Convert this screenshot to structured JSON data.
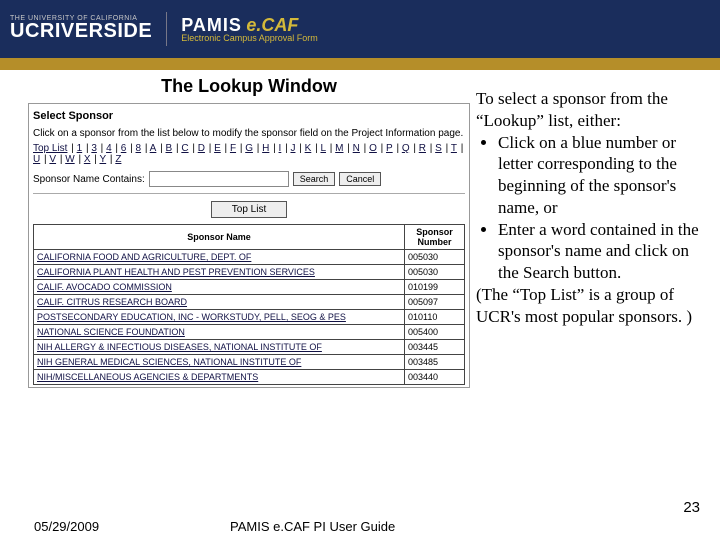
{
  "header": {
    "univ_top": "THE UNIVERSITY OF CALIFORNIA",
    "brand": "UCRIVERSIDE",
    "pamis": "PAMIS",
    "ecaf": "e.CAF",
    "tag": "Electronic Campus Approval Form"
  },
  "caption": "The Lookup Window",
  "lookup": {
    "title": "Select Sponsor",
    "instruction": "Click on a sponsor from the list below to modify the sponsor field on the Project Information page.",
    "top_link": "Top List",
    "digits_letters": [
      "1",
      "3",
      "4",
      "6",
      "8",
      "A",
      "B",
      "C",
      "D",
      "E",
      "F",
      "G",
      "H",
      "I",
      "J",
      "K",
      "L",
      "M",
      "N",
      "O",
      "P",
      "Q",
      "R",
      "S",
      "T",
      "U",
      "V",
      "W",
      "X",
      "Y",
      "Z"
    ],
    "search_label": "Sponsor Name Contains:",
    "search_btn": "Search",
    "cancel_btn": "Cancel",
    "top_list_button": "Top List",
    "table": {
      "headers": [
        "Sponsor Name",
        "Sponsor Number"
      ],
      "rows": [
        [
          "CALIFORNIA FOOD AND AGRICULTURE, DEPT. OF",
          "005030"
        ],
        [
          "CALIFORNIA PLANT HEALTH AND PEST PREVENTION SERVICES",
          "005030"
        ],
        [
          "CALIF. AVOCADO COMMISSION",
          "010199"
        ],
        [
          "CALIF. CITRUS RESEARCH BOARD",
          "005097"
        ],
        [
          "POSTSECONDARY EDUCATION, INC - WORKSTUDY, PELL, SEOG & PES",
          "010110"
        ],
        [
          "NATIONAL SCIENCE FOUNDATION",
          "005400"
        ],
        [
          "NIH ALLERGY & INFECTIOUS DISEASES, NATIONAL INSTITUTE OF",
          "003445"
        ],
        [
          "NIH GENERAL MEDICAL SCIENCES, NATIONAL INSTITUTE OF",
          "003485"
        ],
        [
          "NIH/MISCELLANEOUS AGENCIES & DEPARTMENTS",
          "003440"
        ]
      ]
    }
  },
  "notes": {
    "intro_a": "To select a sponsor from the “Lookup” list, either:",
    "bullet1": "Click on a blue number or letter corresponding to the beginning of the sponsor's name, or",
    "bullet2": "Enter a word contained in the sponsor's name and click on the Search button.",
    "outro": "(The “Top List” is a group of UCR's most popular sponsors. )"
  },
  "footer": {
    "date": "05/29/2009",
    "guide": "PAMIS e.CAF PI User Guide",
    "page": "23"
  }
}
